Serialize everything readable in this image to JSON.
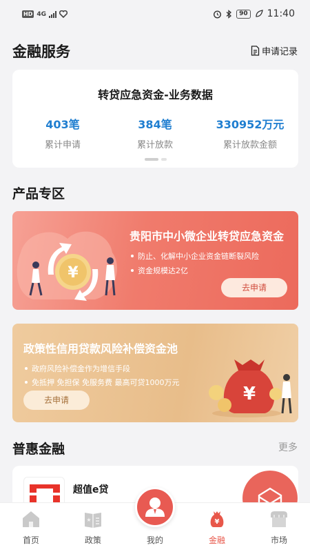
{
  "status_bar": {
    "left_badge": "HD",
    "network": "4G",
    "battery": "90",
    "time": "11:40"
  },
  "header": {
    "title": "金融服务",
    "record_label": "申请记录"
  },
  "stats_card": {
    "title": "转贷应急资金-业务数据",
    "stats": [
      {
        "value": "403笔",
        "label": "累计申请"
      },
      {
        "value": "384笔",
        "label": "累计放款"
      },
      {
        "value": "330952万元",
        "label": "累计放款金额"
      }
    ]
  },
  "products": {
    "title": "产品专区",
    "banners": [
      {
        "title": "贵阳市中小微企业转贷应急资金",
        "bullets": [
          "防止、化解中小企业资金链断裂风险",
          "资金规模达2亿"
        ],
        "button": "去申请"
      },
      {
        "title": "政策性信用贷款风险补偿资金池",
        "bullets": [
          "政府风险补偿金作为增信手段",
          "免抵押 免担保 免服务费 最高可贷1000万元"
        ],
        "button": "去申请"
      }
    ]
  },
  "inclusive": {
    "title": "普惠金融",
    "more": "更多",
    "items": [
      {
        "name": "超值e贷"
      }
    ]
  },
  "tab_bar": {
    "tabs": [
      {
        "label": "首页"
      },
      {
        "label": "政策"
      },
      {
        "label": "我的"
      },
      {
        "label": "金融"
      },
      {
        "label": "市场"
      }
    ]
  },
  "colors": {
    "accent_blue": "#1f7ed0",
    "accent_red": "#e8574a",
    "banner_red": "#ec6a5c",
    "banner_gold": "#e8bd8a"
  }
}
